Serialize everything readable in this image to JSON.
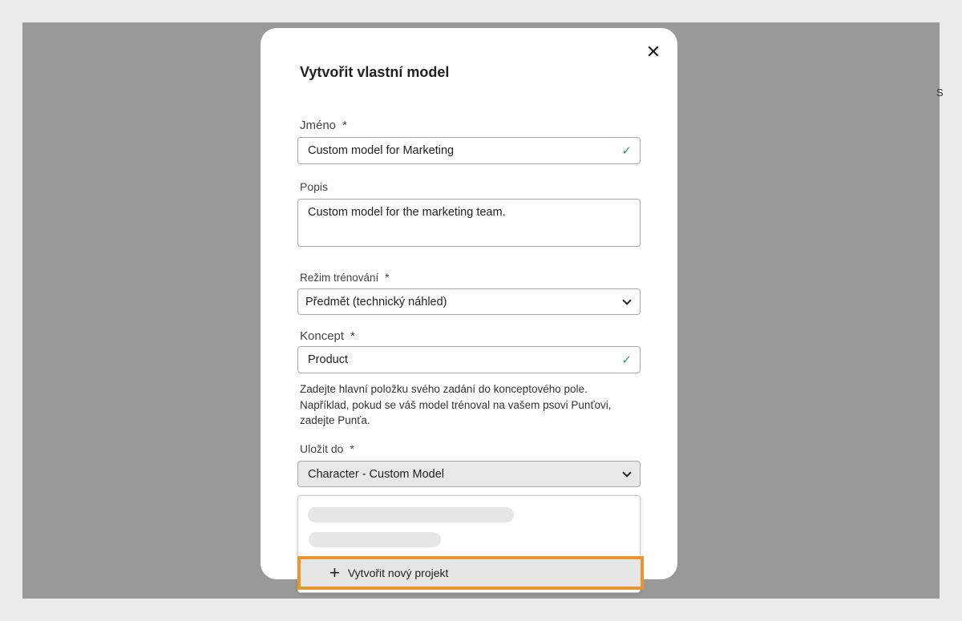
{
  "background_edge_text": "S",
  "dialog": {
    "title": "Vytvořit vlastní model",
    "close_icon": "close-icon",
    "name": {
      "label": "Jméno",
      "required": "*",
      "value": "Custom model for Marketing",
      "valid": true
    },
    "description": {
      "label": "Popis",
      "value": "Custom model for the marketing team."
    },
    "training_mode": {
      "label": "Režim trénování",
      "required": "*",
      "selected": "Předmět (technický náhled)"
    },
    "concept": {
      "label": "Koncept",
      "required": "*",
      "value": "Product",
      "valid": true,
      "help": "Zadejte hlavní položku svého zadání do konceptového pole. Například, pokud se váš model trénoval na vašem psovi Punťovi, zadejte Punťa."
    },
    "save_to": {
      "label": "Uložit do",
      "required": "*",
      "selected": "Character - Custom Model",
      "menu": {
        "loading_placeholders": 2,
        "create_new_label": "Vytvořit nový projekt"
      }
    }
  },
  "colors": {
    "highlight": "#e8962d",
    "valid_check": "#2d9d78",
    "overlay": "#999999"
  }
}
